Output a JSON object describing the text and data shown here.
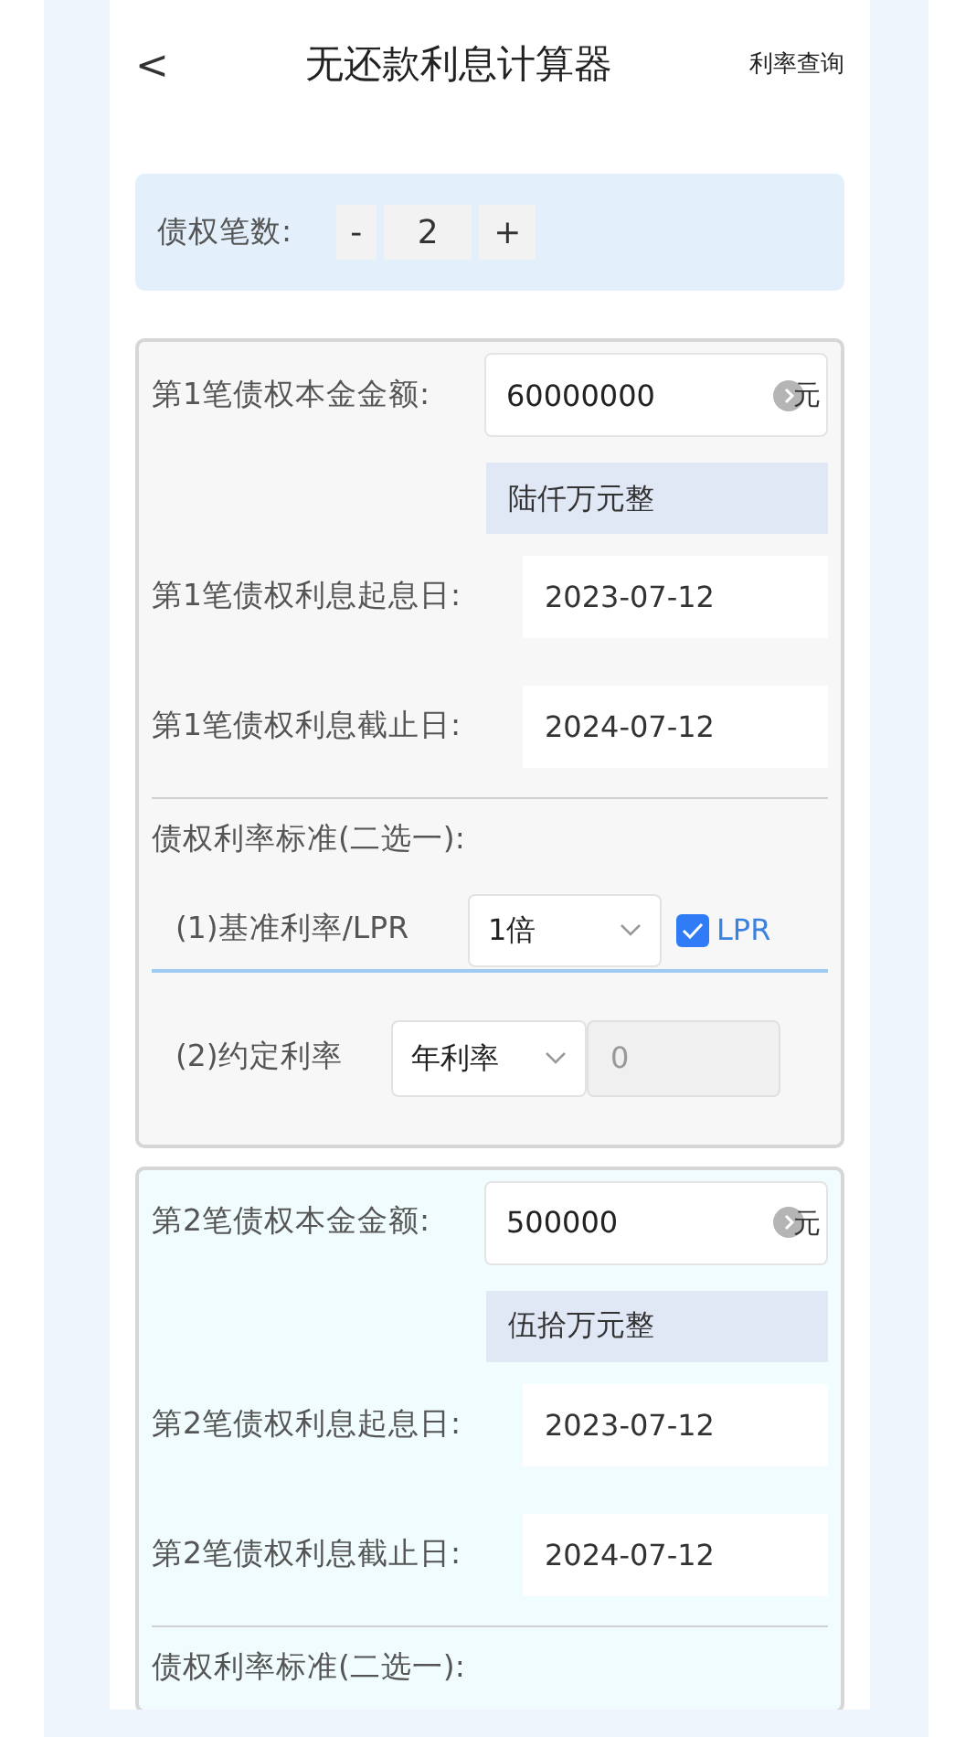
{
  "header": {
    "back": "<",
    "title": "无还款利息计算器",
    "link": "利率查询"
  },
  "count": {
    "label": "债权笔数:",
    "minus": "-",
    "value": "2",
    "plus": "+"
  },
  "claims": [
    {
      "color": "#f7f7f7",
      "principal_label": "第1笔债权本金金额:",
      "principal_value": "60000000",
      "unit": "元",
      "amount_words": "陆仟万元整",
      "start_label": "第1笔债权利息起息日:",
      "start_date": "2023-07-12",
      "end_label": "第1笔债权利息截止日:",
      "end_date": "2024-07-12",
      "rate_heading": "债权利率标准(二选一):",
      "base_rate_label": "(1)基准利率/LPR",
      "multiplier": "1倍",
      "lpr_checked": true,
      "lpr_label": "LPR",
      "agreed_label": "(2)约定利率",
      "agreed_type": "年利率",
      "agreed_placeholder": "0",
      "agreed_disabled": true
    },
    {
      "color": "#f0fcfd",
      "principal_label": "第2笔债权本金金额:",
      "principal_value": "500000",
      "unit": "元",
      "amount_words": "伍拾万元整",
      "start_label": "第2笔债权利息起息日:",
      "start_date": "2023-07-12",
      "end_label": "第2笔债权利息截止日:",
      "end_date": "2024-07-12",
      "rate_heading": "债权利率标准(二选一):"
    }
  ]
}
